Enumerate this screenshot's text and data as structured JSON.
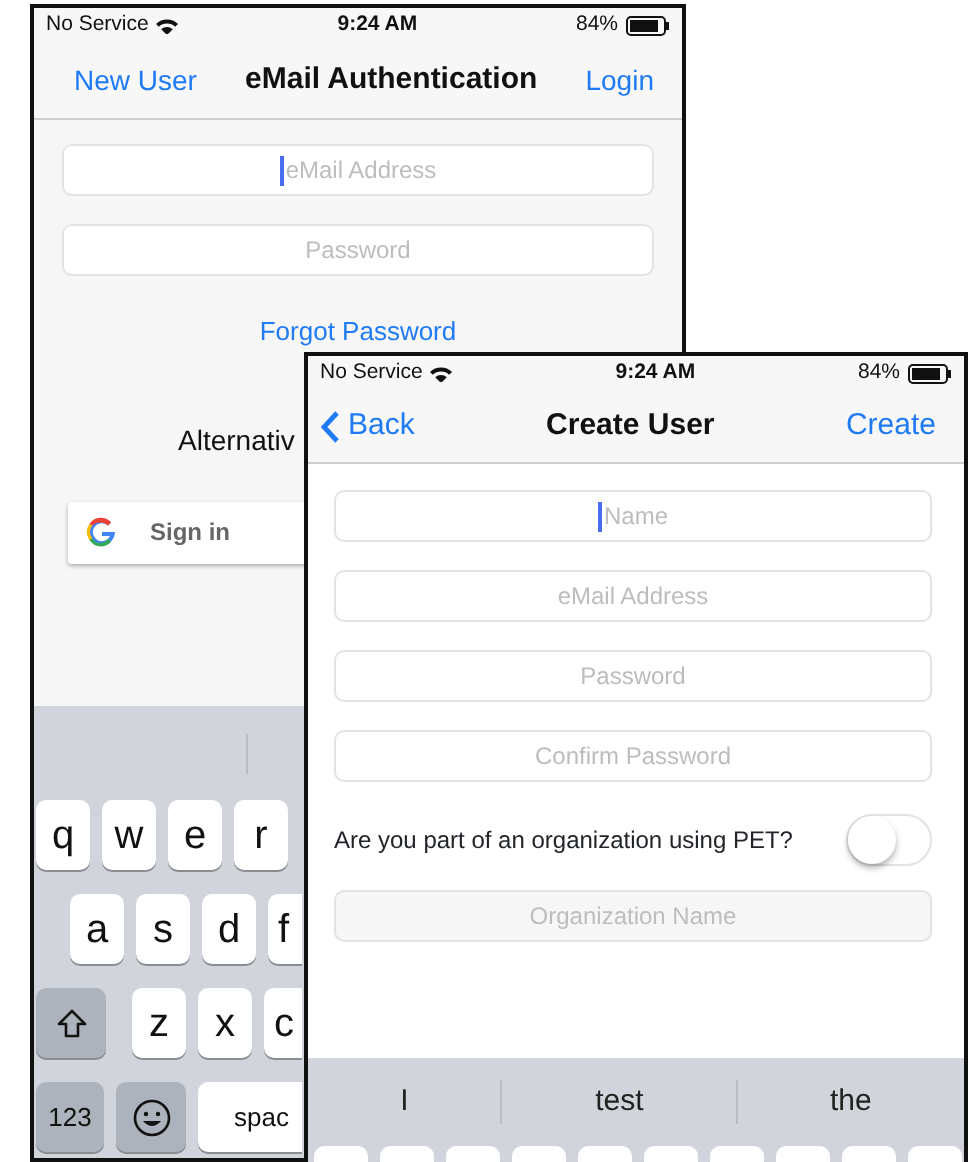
{
  "back_screen": {
    "status_bar": {
      "carrier": "No Service",
      "time": "9:24 AM",
      "battery": "84%"
    },
    "nav": {
      "left": "New User",
      "title": "eMail Authentication",
      "right": "Login"
    },
    "fields": [
      {
        "placeholder": "eMail Address",
        "focused": true
      },
      {
        "placeholder": "Password",
        "focused": false
      }
    ],
    "forgot_link": "Forgot Password",
    "alternative_heading": "Alternativ",
    "google_button": "Sign in",
    "keyboard": {
      "rows": [
        [
          {
            "kind": "letter",
            "label": "q"
          },
          {
            "kind": "letter",
            "label": "w"
          },
          {
            "kind": "letter",
            "label": "e"
          },
          {
            "kind": "letter",
            "label": "r"
          }
        ],
        [
          {
            "kind": "letter",
            "label": "a"
          },
          {
            "kind": "letter",
            "label": "s"
          },
          {
            "kind": "letter",
            "label": "d"
          },
          {
            "kind": "letter",
            "label": "f"
          }
        ],
        [
          {
            "kind": "shift"
          },
          {
            "kind": "letter",
            "label": "z"
          },
          {
            "kind": "letter",
            "label": "x"
          },
          {
            "kind": "letter",
            "label": "c"
          }
        ],
        [
          {
            "kind": "function",
            "label": "123"
          },
          {
            "kind": "emoji"
          },
          {
            "kind": "space",
            "label": "spac"
          }
        ]
      ]
    }
  },
  "front_screen": {
    "status_bar": {
      "carrier": "No Service",
      "time": "9:24 AM",
      "battery": "84%"
    },
    "nav": {
      "back": "Back",
      "title": "Create User",
      "right": "Create"
    },
    "fields": [
      {
        "placeholder": "Name",
        "focused": true
      },
      {
        "placeholder": "eMail Address",
        "focused": false
      },
      {
        "placeholder": "Password",
        "focused": false
      },
      {
        "placeholder": "Confirm Password",
        "focused": false
      }
    ],
    "toggle": {
      "label": "Are you part of an organization using PET?",
      "on": false
    },
    "organization_field": {
      "placeholder": "Organization Name",
      "disabled": true
    },
    "keyboard": {
      "suggestions": [
        "I",
        "test",
        "the"
      ]
    }
  }
}
